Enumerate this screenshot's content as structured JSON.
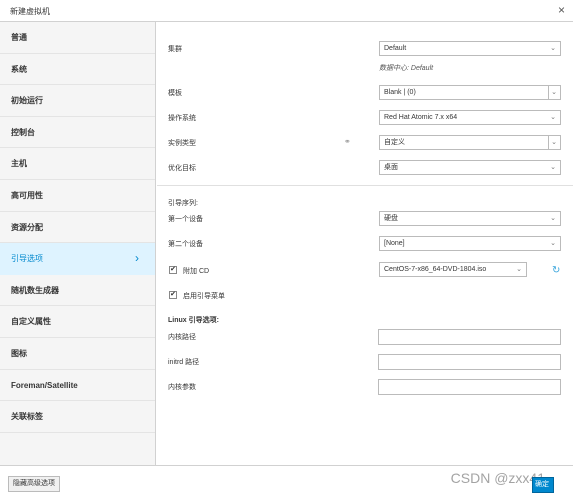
{
  "window": {
    "title": "新建虚拟机",
    "close_glyph": "×"
  },
  "sidebar": {
    "items": [
      {
        "label": "普通"
      },
      {
        "label": "系统"
      },
      {
        "label": "初始运行"
      },
      {
        "label": "控制台"
      },
      {
        "label": "主机"
      },
      {
        "label": "高可用性"
      },
      {
        "label": "资源分配"
      },
      {
        "label": "引导选项",
        "active": true
      },
      {
        "label": "随机数生成器"
      },
      {
        "label": "自定义属性"
      },
      {
        "label": "图标"
      },
      {
        "label": "Foreman/Satellite"
      },
      {
        "label": "关联标签"
      }
    ],
    "active_chevron": "›"
  },
  "form": {
    "cluster": {
      "label": "集群",
      "value": "Default",
      "hint": "数据中心: Default"
    },
    "template": {
      "label": "模板",
      "value": "Blank | (0)"
    },
    "os": {
      "label": "操作系统",
      "value": "Red Hat Atomic 7.x x64"
    },
    "instance_type": {
      "label": "实例类型",
      "value": "自定义"
    },
    "optimize": {
      "label": "优化目标",
      "value": "桌面"
    },
    "boot_sequence": {
      "section_label": "引导序列:",
      "first_device": {
        "label": "第一个设备",
        "value": "硬盘"
      },
      "second_device": {
        "label": "第二个设备",
        "value": "[None]"
      }
    },
    "attach_cd": {
      "label": "附加 CD",
      "checked": true,
      "value": "CentOS-7-x86_64-DVD-1804.iso"
    },
    "boot_menu": {
      "label": "启用引导菜单",
      "checked": true
    },
    "linux_boot": {
      "section_label": "Linux 引导选项:",
      "kernel_path": {
        "label": "内核路径",
        "value": ""
      },
      "initrd_path": {
        "label": "initrd 路径",
        "value": ""
      },
      "kernel_params": {
        "label": "内核参数",
        "value": ""
      }
    },
    "check_glyph": "✔",
    "arrow_glyph": "⌄",
    "link_icon_glyph": "⚭",
    "refresh_glyph": "↻"
  },
  "footer": {
    "advanced_button": "隐藏高级选项",
    "ok_button": "确定",
    "watermark": "CSDN @zxx41"
  },
  "colors": {
    "accent": "#0088ce",
    "active_bg": "#def3ff",
    "sidebar_bg": "#f5f5f5"
  }
}
